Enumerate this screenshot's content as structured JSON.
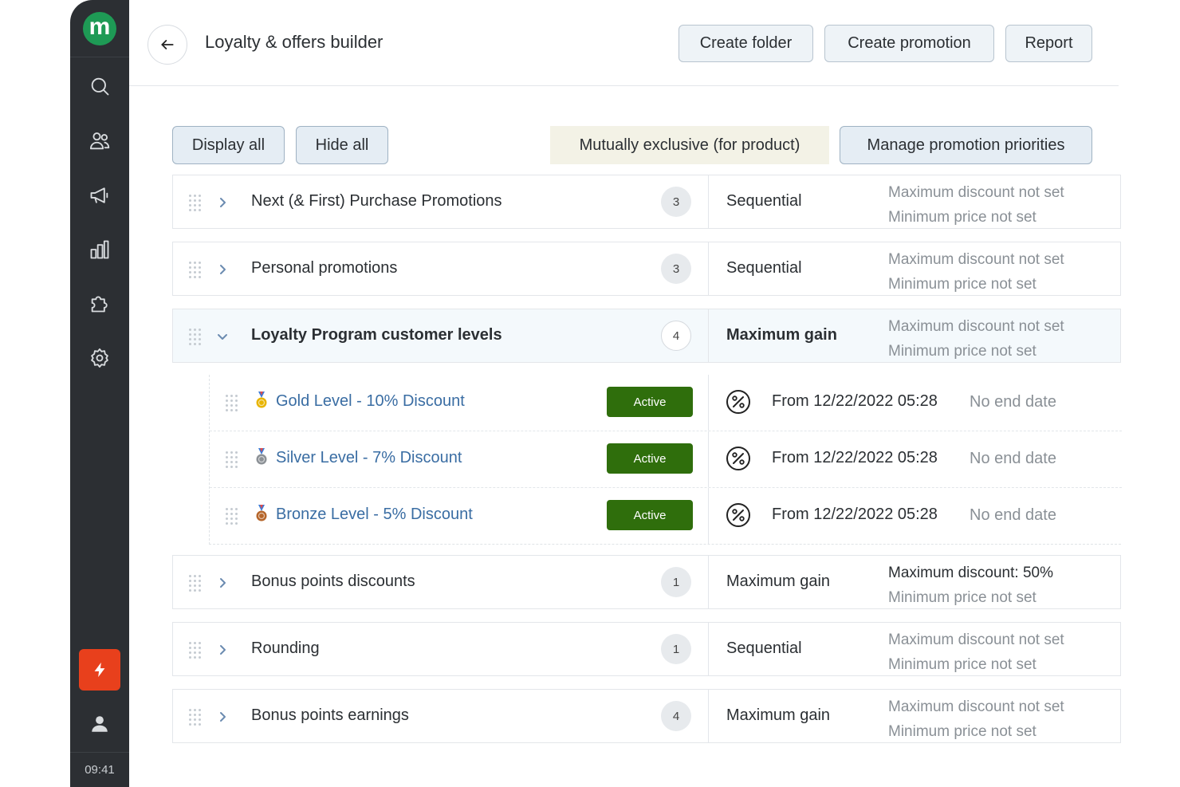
{
  "app": {
    "logo_letter": "m",
    "time": "09:41"
  },
  "header": {
    "title": "Loyalty & offers builder",
    "buttons": {
      "create_folder": "Create folder",
      "create_promotion": "Create promotion",
      "report": "Report"
    }
  },
  "toolbar": {
    "display_all": "Display all",
    "hide_all": "Hide all",
    "mutually_exclusive": "Mutually exclusive (for product)",
    "manage_priorities": "Manage promotion priorities"
  },
  "folders": [
    {
      "title": "Next (& First) Purchase Promotions",
      "count": "3",
      "mode": "Sequential",
      "max": "Maximum discount not set",
      "min": "Minimum price not set",
      "expanded": false
    },
    {
      "title": "Personal promotions",
      "count": "3",
      "mode": "Sequential",
      "max": "Maximum discount not set",
      "min": "Minimum price not set",
      "expanded": false
    },
    {
      "title": "Loyalty Program customer levels",
      "count": "4",
      "mode": "Maximum gain",
      "max": "Maximum discount not set",
      "min": "Minimum price not set",
      "expanded": true
    },
    {
      "title": "Bonus points discounts",
      "count": "1",
      "mode": "Maximum gain",
      "max": "Maximum discount: 50%",
      "min": "Minimum price not set",
      "expanded": false
    },
    {
      "title": "Rounding",
      "count": "1",
      "mode": "Sequential",
      "max": "Maximum discount not set",
      "min": "Minimum price not set",
      "expanded": false
    },
    {
      "title": "Bonus points earnings",
      "count": "4",
      "mode": "Maximum gain",
      "max": "Maximum discount not set",
      "min": "Minimum price not set",
      "expanded": false
    }
  ],
  "promotions": [
    {
      "title": "Gold Level - 10% Discount",
      "medal": "gold-medal-icon",
      "status": "Active",
      "from": "From 12/22/2022 05:28",
      "end": "No end date"
    },
    {
      "title": "Silver Level - 7% Discount",
      "medal": "silver-medal-icon",
      "status": "Active",
      "from": "From 12/22/2022 05:28",
      "end": "No end date"
    },
    {
      "title": "Bronze Level - 5% Discount",
      "medal": "bronze-medal-icon",
      "status": "Active",
      "from": "From 12/22/2022 05:28",
      "end": "No end date"
    }
  ],
  "colors": {
    "brand_green": "#1e9a55",
    "sidebar": "#2c2f33",
    "flash": "#e8401c",
    "active_badge": "#2f6e0c",
    "link_blue": "#3a6da3",
    "gold": "#e8b400",
    "silver": "#8c9196",
    "bronze": "#b5652a"
  },
  "icons": [
    "search-icon",
    "users-icon",
    "megaphone-icon",
    "chart-icon",
    "puzzle-icon",
    "gear-icon",
    "flash-icon",
    "user-icon",
    "back-arrow-icon",
    "drag-handle-icon",
    "chevron-right-icon",
    "chevron-down-icon",
    "percent-icon"
  ]
}
